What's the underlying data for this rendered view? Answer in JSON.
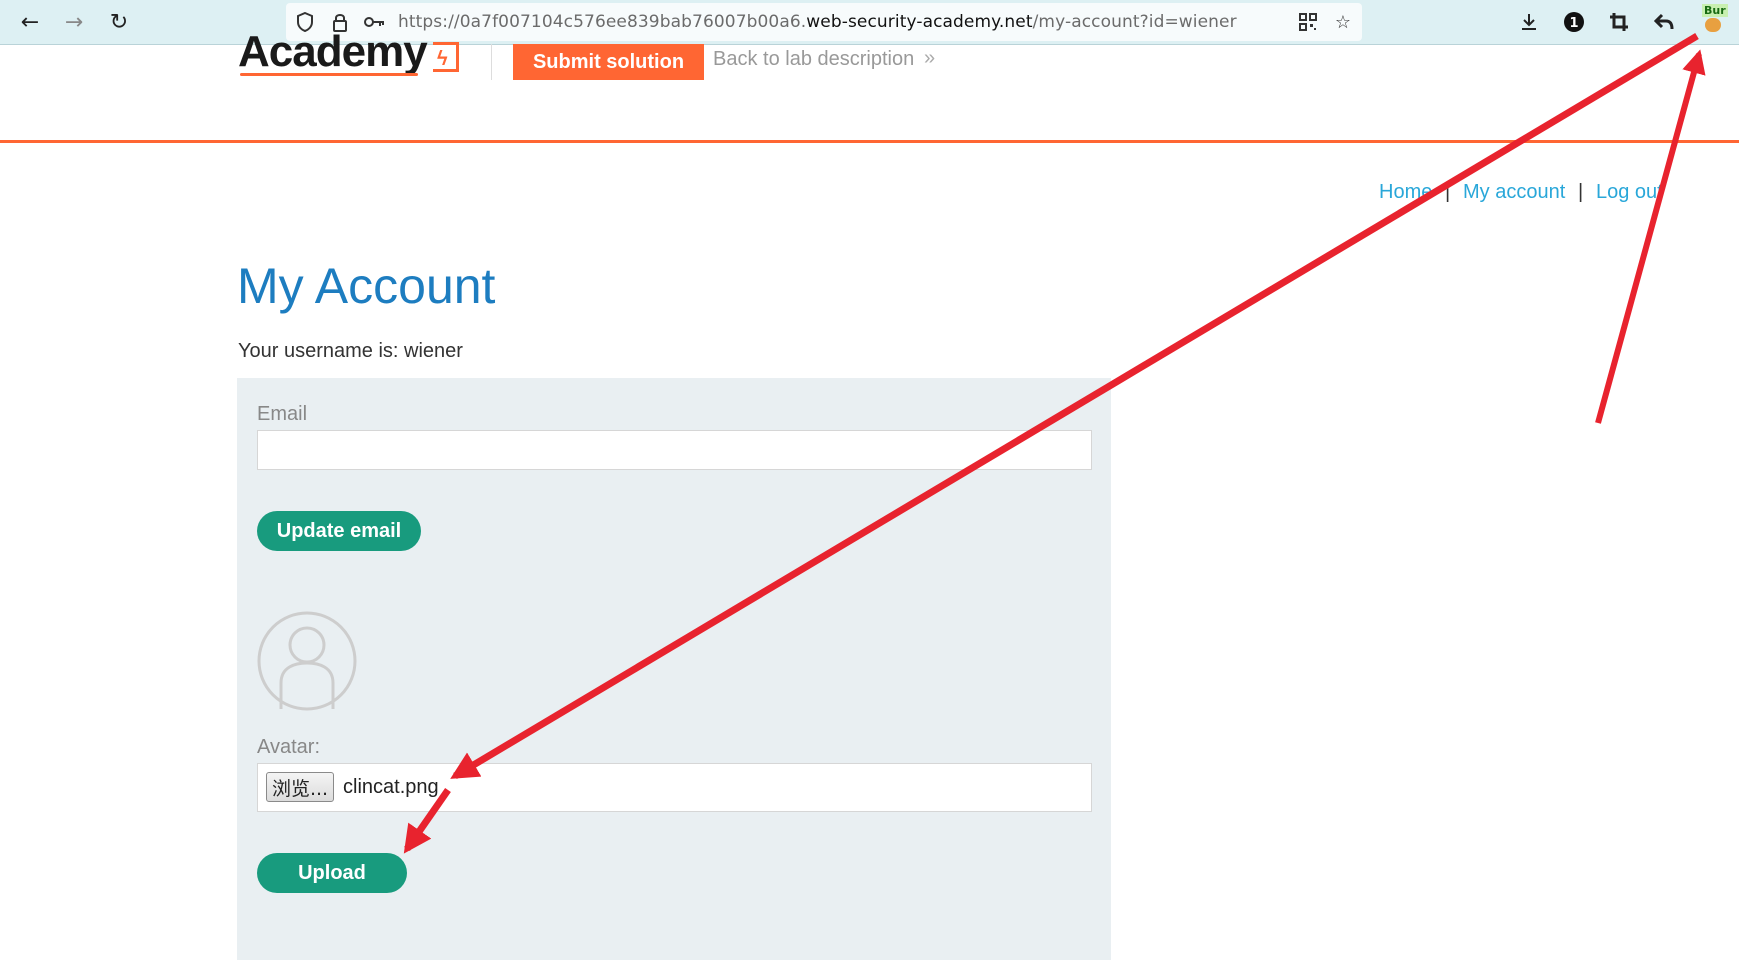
{
  "browser": {
    "url_prefix": "https://0a7f007104c576ee839bab76007b00a6.",
    "url_domain": "web-security-academy.net",
    "url_path": "/my-account?id=wiener",
    "extension_badge": "Bur"
  },
  "header": {
    "logo_text": "Academy",
    "submit_label": "Submit solution",
    "back_label": "Back to lab description",
    "back_chevron": "»"
  },
  "nav": {
    "home": "Home",
    "sep1": "|",
    "my_account": "My account",
    "sep2": "|",
    "log_out": "Log out"
  },
  "page": {
    "title": "My Account",
    "username_text": "Your username is: wiener"
  },
  "form": {
    "email_label": "Email",
    "email_value": "",
    "update_label": "Update email",
    "avatar_label": "Avatar:",
    "browse_label": "浏览...",
    "file_name": "clincat.png",
    "upload_label": "Upload"
  },
  "colors": {
    "accent_orange": "#ff6633",
    "title_blue": "#1d7dc0",
    "link_blue": "#29a7d9",
    "button_green": "#189b7e",
    "panel_bg": "#e9eff2",
    "annotation_red": "#e8232e"
  }
}
